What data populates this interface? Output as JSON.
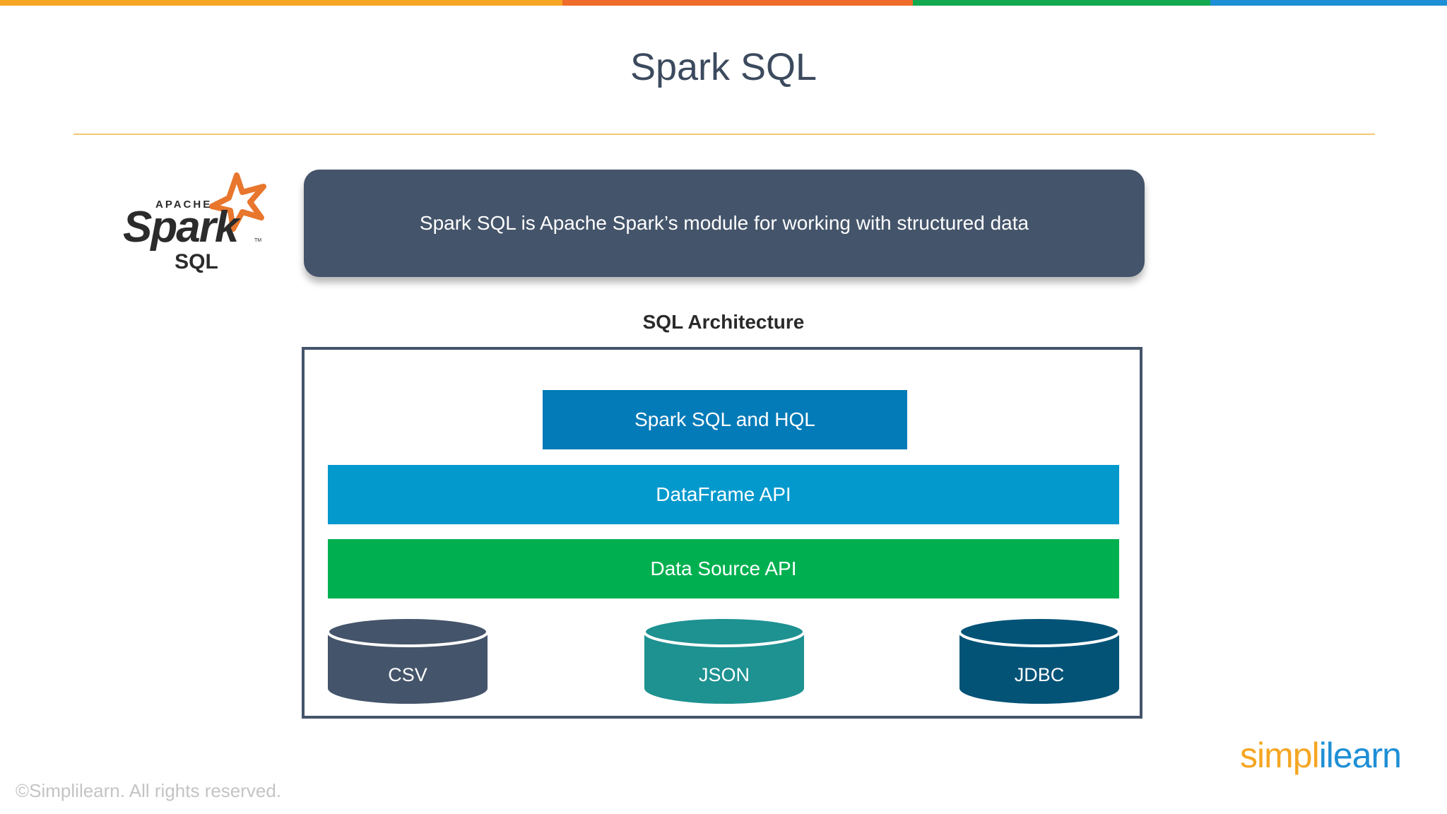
{
  "colors": {
    "top_bar": [
      "#f5a623",
      "#ef6c2a",
      "#12a94f",
      "#1e8fd5"
    ],
    "title_rule": "#f0c870",
    "banner": "#44546a",
    "spark_sql_hql": "#037bb8",
    "dataframe_api": "#0399cd",
    "data_source_api": "#00b050",
    "csv": "#44546a",
    "json": "#1e9191",
    "jdbc": "#035377",
    "spark_star": "#e8762c"
  },
  "slide": {
    "title": "Spark SQL"
  },
  "logo": {
    "apache": "APACHE",
    "spark": "Spark",
    "tm": "TM",
    "sql": "SQL"
  },
  "banner": {
    "text": "Spark SQL is Apache Spark’s module for working with structured data"
  },
  "architecture": {
    "label": "SQL Architecture",
    "layers": {
      "sql_hql": "Spark SQL and HQL",
      "dataframe": "DataFrame API",
      "data_source": "Data Source API"
    },
    "sources": {
      "csv": "CSV",
      "json": "JSON",
      "jdbc": "JDBC"
    }
  },
  "footer": {
    "copyright": "©Simplilearn. All rights reserved.",
    "brand": "simplilearn",
    "brand_colors": [
      "#f5a623",
      "#1e8fd5"
    ]
  }
}
